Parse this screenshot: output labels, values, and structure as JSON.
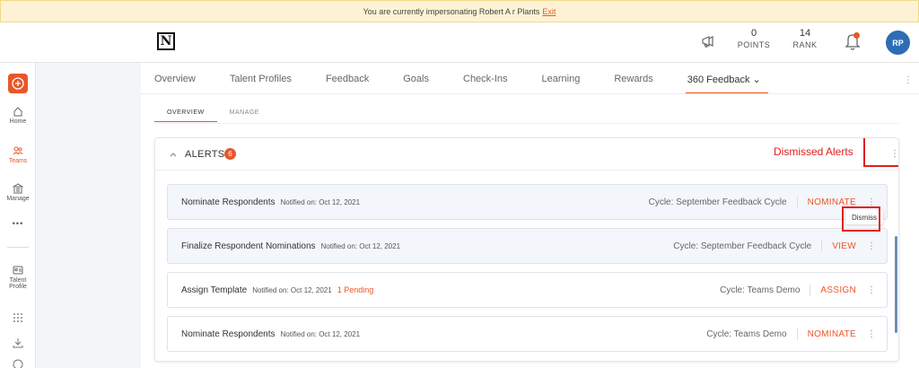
{
  "banner": {
    "text": "You are currently impersonating Robert A r Plants",
    "exit": "Exit"
  },
  "topbar": {
    "logo": "N",
    "points": {
      "value": "0",
      "label": "POINTS"
    },
    "rank": {
      "value": "14",
      "label": "RANK"
    },
    "avatar": "RP"
  },
  "sidebar": {
    "items": [
      {
        "label": "Home",
        "icon": "home-icon"
      },
      {
        "label": "Teams",
        "icon": "teams-icon"
      },
      {
        "label": "Manage",
        "icon": "manage-icon"
      },
      {
        "label": "•••",
        "icon": "more-icon"
      },
      {
        "label": "Talent Profile",
        "icon": "talent-profile-icon"
      }
    ]
  },
  "tabs": [
    "Overview",
    "Talent Profiles",
    "Feedback",
    "Goals",
    "Check-Ins",
    "Learning",
    "Rewards",
    "360 Feedback"
  ],
  "subtabs": [
    "OVERVIEW",
    "MANAGE"
  ],
  "alerts": {
    "title": "ALERTS",
    "count": "6",
    "dismissed_label": "Dismissed Alerts",
    "dismiss_menu": "Dismiss",
    "rows": [
      {
        "name": "Nominate Respondents",
        "notified": "Notified on: Oct 12, 2021",
        "pending": "",
        "cycle": "Cycle: September Feedback Cycle",
        "action": "NOMINATE"
      },
      {
        "name": "Finalize Respondent Nominations",
        "notified": "Notified on: Oct 12, 2021",
        "pending": "",
        "cycle": "Cycle: September Feedback Cycle",
        "action": "VIEW"
      },
      {
        "name": "Assign Template",
        "notified": "Notified on: Oct 12, 2021",
        "pending": "1 Pending",
        "cycle": "Cycle: Teams Demo",
        "action": "ASSIGN"
      },
      {
        "name": "Nominate Respondents",
        "notified": "Notified on: Oct 12, 2021",
        "pending": "",
        "cycle": "Cycle: Teams Demo",
        "action": "NOMINATE"
      }
    ]
  },
  "colors": {
    "accent": "#e8572a",
    "annotation": "#e02020",
    "avatar": "#2d6db5"
  }
}
